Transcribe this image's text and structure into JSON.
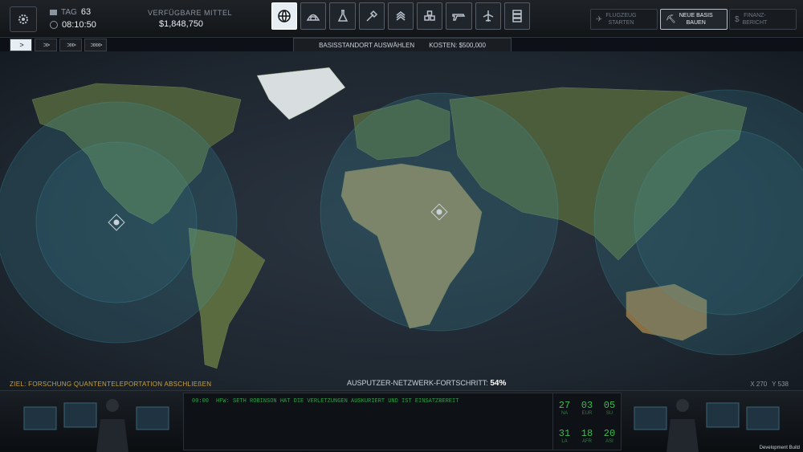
{
  "topbar": {
    "day_label": "TAG",
    "day_value": "63",
    "time_value": "08:10:50",
    "funds_label": "VERFÜGBARE MITTEL",
    "funds_value": "$1,848,750",
    "nav_icons": [
      "globe-icon",
      "hangar-icon",
      "research-icon",
      "engineering-icon",
      "rank-icon",
      "storage-icon",
      "weapon-icon",
      "aircraft-icon",
      "server-icon"
    ],
    "launch_label_1": "FLUGZEUG",
    "launch_label_2": "STARTEN",
    "newbase_label_1": "NEUE BASIS",
    "newbase_label_2": "BAUEN",
    "finance_label_1": "FINANZ-",
    "finance_label_2": "BERICHT"
  },
  "speed": {
    "buttons": [
      ">",
      ">>",
      ">>>",
      ">>>>"
    ]
  },
  "banner": {
    "title": "BASISSTANDORT AUSWÄHLEN",
    "cost_label": "KOSTEN:",
    "cost_value": "$500,000"
  },
  "map_info": {
    "goal": "ZIEL: FORSCHUNG QUANTENTELEPORTATION ABSCHLIEßEN",
    "progress_label": "AUSPUTZER-NETZWERK-FORTSCHRITT:",
    "progress_value": "54%",
    "coord_x": "X 270",
    "coord_y": "Y 538"
  },
  "feed": {
    "time": "00:00",
    "message": "HFW: SETH ROBINSON HAT DIE VERLETZUNGEN AUSKURIERT UND IST EINSATZBEREIT"
  },
  "stats": [
    {
      "num": "27",
      "lbl": "NA"
    },
    {
      "num": "03",
      "lbl": "EUR"
    },
    {
      "num": "05",
      "lbl": "SU"
    },
    {
      "num": "31",
      "lbl": "LA"
    },
    {
      "num": "18",
      "lbl": "AFR"
    },
    {
      "num": "20",
      "lbl": "ASI"
    }
  ],
  "footer": {
    "dev_build": "Development Build"
  },
  "colors": {
    "accent": "#3fb950",
    "goal": "#c8a040",
    "radar": "#3fa3b8"
  }
}
